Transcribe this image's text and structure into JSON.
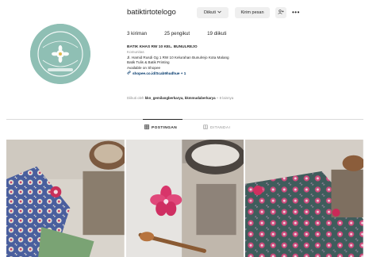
{
  "profile": {
    "username": "batiktirtotelogo",
    "buttons": {
      "follow": "Diikuti",
      "message": "Kirim pesan"
    },
    "stats": {
      "posts": "3 kiriman",
      "followers": "25 pengikut",
      "following": "19 diikuti"
    },
    "bio": {
      "name": "BATIK KHAS RW 10 KEL. BUNULREJO",
      "category": "Komunitas",
      "lines": [
        "Jl. Hamid Rusdi Gg 1 RW 10 Kelurahan Bunulrejo Kota Malang",
        "Batik Tulis & Batik Printing",
        "Available on Shopee"
      ],
      "link": "shopee.co.id/Scab9hudhue + 1"
    },
    "followed_by": {
      "prefix": "Diikuti oleh",
      "names": "kkn_gemilangberkarya, kkmmudaberkarya",
      "suffix": "+ 8 lainnya"
    }
  },
  "tabs": {
    "posts": "POSTINGAN",
    "tagged": "DITANDAI"
  },
  "icons": {
    "follow_caret": "chevron-down-icon",
    "suggest": "add-person-icon",
    "more": "more-icon",
    "link": "link-icon",
    "posts": "grid-icon",
    "tagged": "tag-icon"
  },
  "colors": {
    "avatar_bg": "#8fbfb4",
    "button_bg": "#efefef",
    "link": "#00376b",
    "muted": "#8e8e8e"
  }
}
